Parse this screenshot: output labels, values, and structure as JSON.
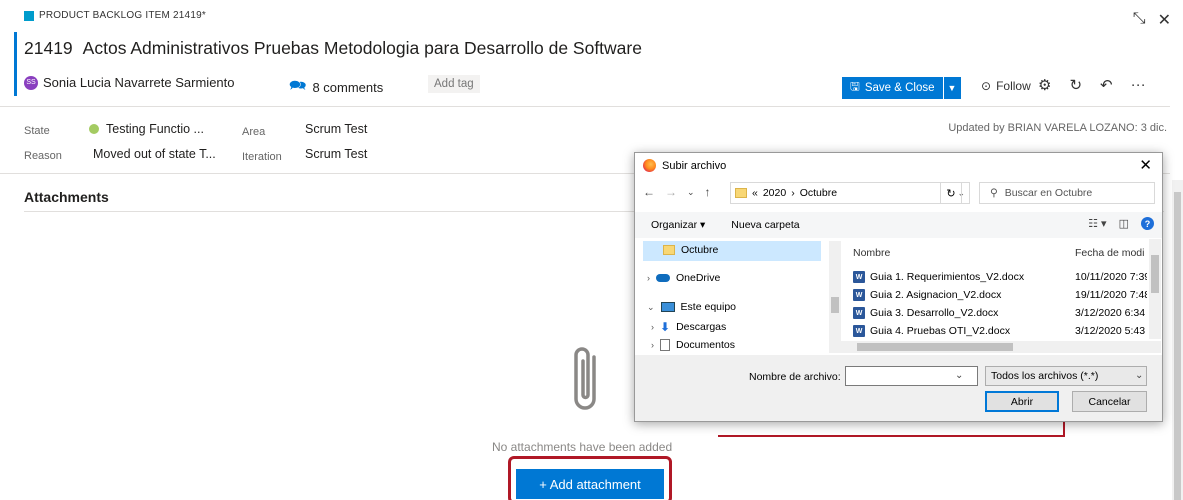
{
  "header": {
    "item_type": "PRODUCT BACKLOG ITEM 21419*",
    "id": "21419",
    "title": "Actos Administrativos Pruebas Metodologia para Desarrollo de Software",
    "avatar_initials": "SS",
    "user": "Sonia Lucia Navarrete Sarmiento",
    "comments": "8 comments",
    "add_tag": "Add tag",
    "save_close": "Save & Close",
    "follow": "Follow"
  },
  "fields": {
    "state_label": "State",
    "state_value": "Testing Functio ...",
    "reason_label": "Reason",
    "reason_value": "Moved out of state T...",
    "area_label": "Area",
    "area_value": "Scrum Test",
    "iteration_label": "Iteration",
    "iteration_value": "Scrum Test",
    "updated": "Updated by BRIAN VARELA LOZANO: 3 dic."
  },
  "attachments": {
    "title": "Attachments",
    "empty_text": "No attachments have been added",
    "add_button": "+ Add attachment"
  },
  "dialog": {
    "title": "Subir archivo",
    "path_root": "«",
    "path_1": "2020",
    "path_sep": "›",
    "path_2": "Octubre",
    "search_placeholder": "Buscar en Octubre",
    "organize": "Organizar ▾",
    "new_folder": "Nueva carpeta",
    "tree": [
      {
        "label": "Octubre"
      },
      {
        "label": "OneDrive"
      },
      {
        "label": "Este equipo"
      },
      {
        "label": "Descargas"
      },
      {
        "label": "Documentos"
      }
    ],
    "col_name": "Nombre",
    "col_date": "Fecha de modi",
    "files": [
      {
        "name": "Guia 1. Requerimientos_V2.docx",
        "date": "10/11/2020 7:39"
      },
      {
        "name": "Guia 2. Asignacion_V2.docx",
        "date": "19/11/2020 7:48"
      },
      {
        "name": "Guia 3. Desarrollo_V2.docx",
        "date": "3/12/2020 6:34"
      },
      {
        "name": "Guia 4. Pruebas OTI_V2.docx",
        "date": "3/12/2020 5:43"
      }
    ],
    "filename_label": "Nombre de archivo:",
    "filter": "Todos los archivos (*.*)",
    "open": "Abrir",
    "cancel": "Cancelar"
  },
  "colors": {
    "accent": "#0078d4",
    "annotation": "#b01826",
    "state_dot": "#a4cb62"
  },
  "icons": [
    "backlog-item-icon",
    "minimize-icon",
    "close-icon",
    "comments-icon",
    "save-icon",
    "follow-icon",
    "settings-icon",
    "refresh-icon",
    "undo-icon",
    "more-icon",
    "paperclip-icon",
    "firefox-icon",
    "folder-icon",
    "onedrive-icon",
    "computer-icon",
    "download-icon",
    "documents-icon",
    "word-icon",
    "search-icon",
    "help-icon"
  ]
}
